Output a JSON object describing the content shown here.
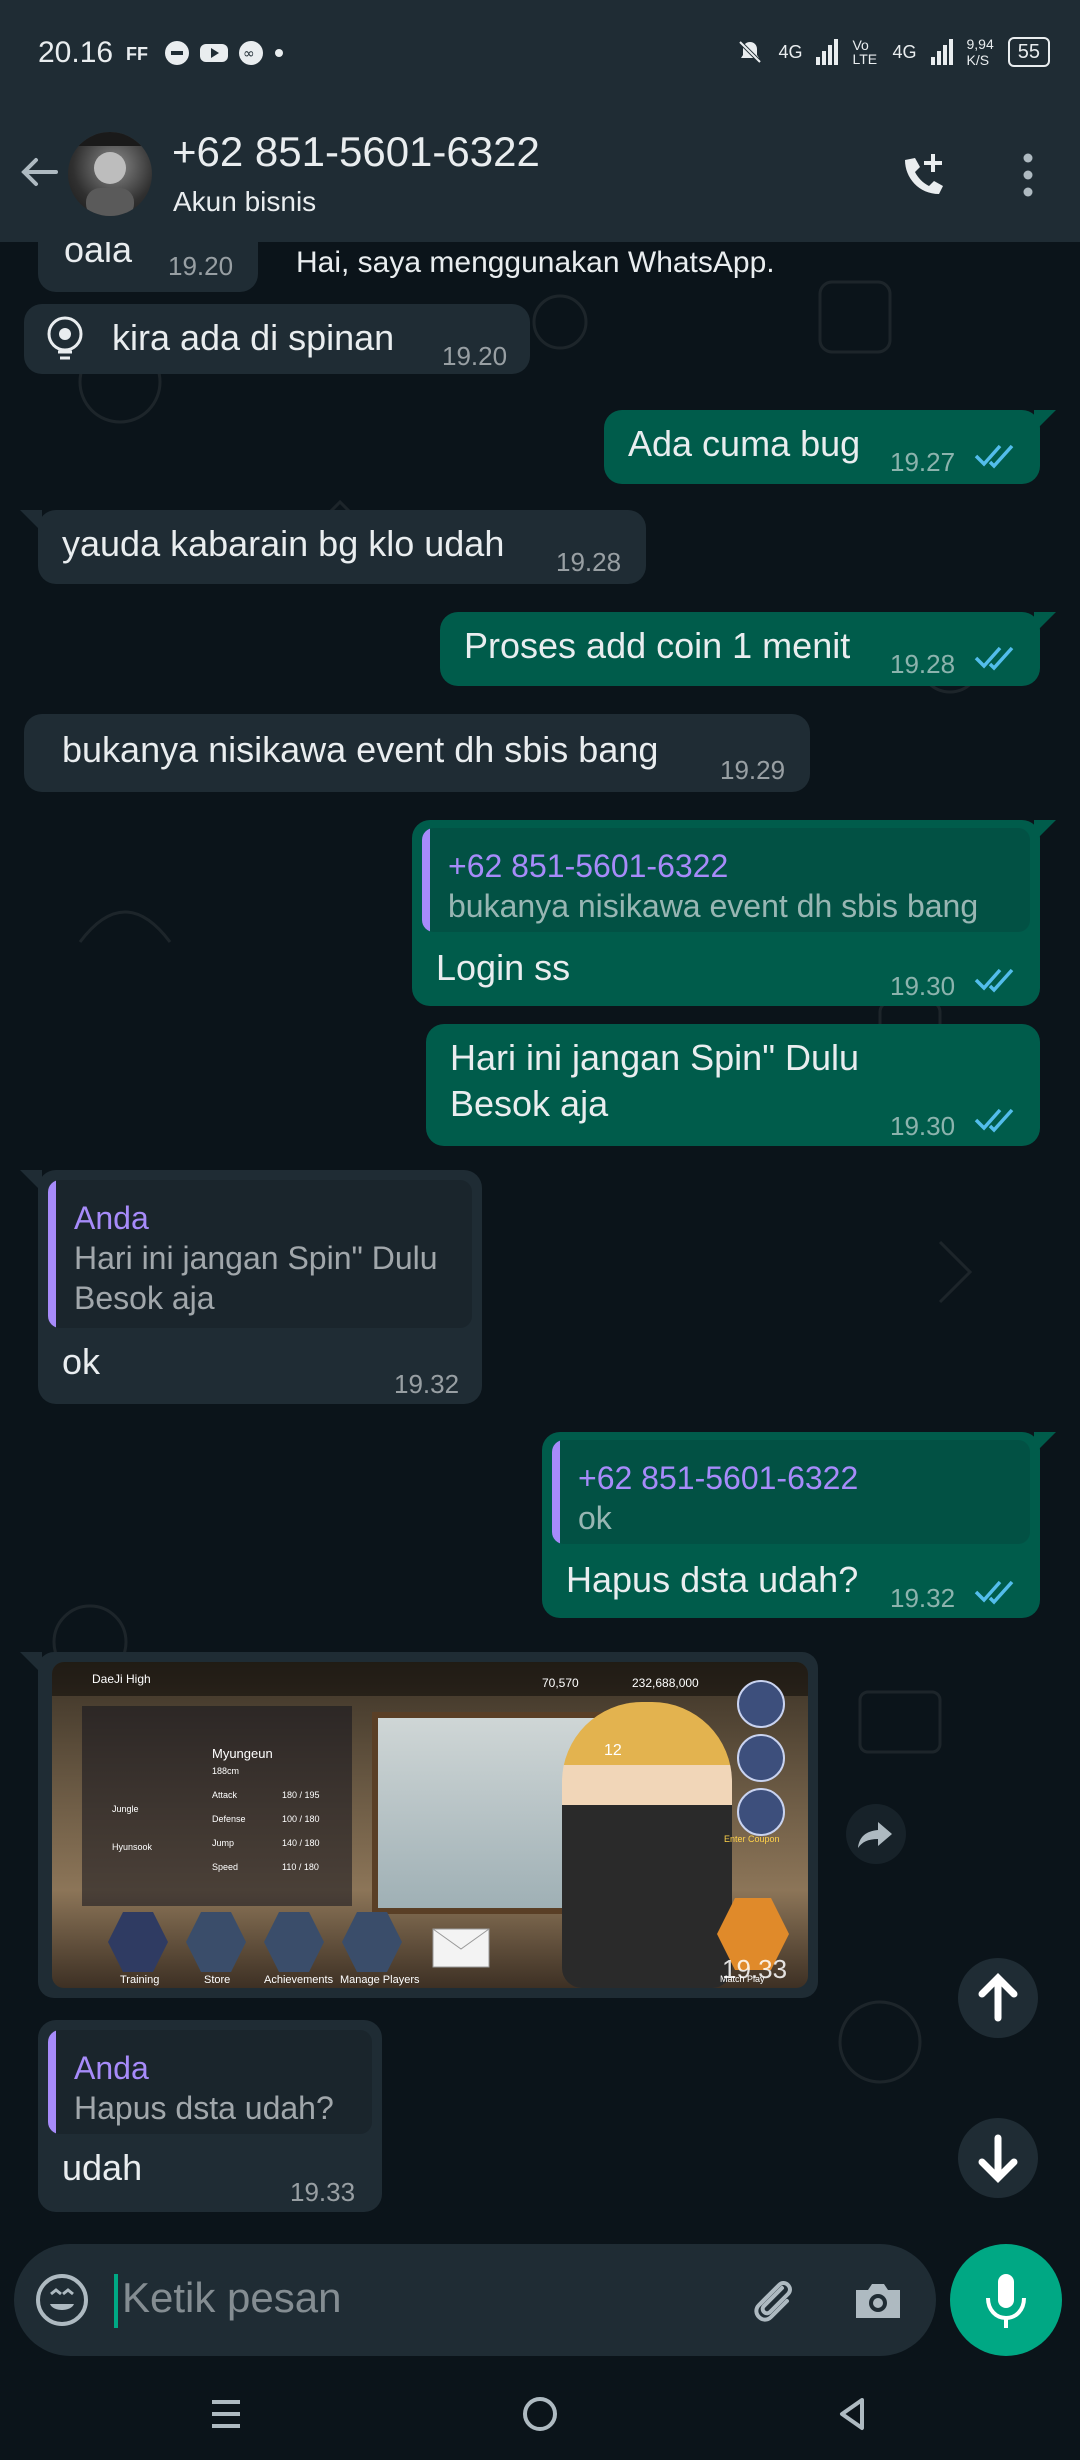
{
  "status_bar": {
    "time": "20.16",
    "net1": "4G",
    "volte": "Vo LTE",
    "net2": "4G",
    "speed": "9,94",
    "speed_unit": "K/S",
    "battery": "55"
  },
  "header": {
    "contact_name": "+62 851-5601-6322",
    "subtitle": "Akun bisnis"
  },
  "messages": [
    {
      "text": "oala",
      "time": "19.20"
    },
    {
      "text": "Hai, saya menggunakan WhatsApp."
    },
    {
      "text": "kira ada di spinan",
      "time": "19.20"
    },
    {
      "text": "Ada cuma bug",
      "time": "19.27"
    },
    {
      "text": "yauda kabarain bg klo udah",
      "time": "19.28"
    },
    {
      "text": "Proses add coin 1 menit",
      "time": "19.28"
    },
    {
      "text": "bukanya nisikawa event dh sbis bang",
      "time": "19.29"
    },
    {
      "quote_name": "+62 851-5601-6322",
      "quote_text": "bukanya nisikawa event dh sbis bang",
      "text": "Login ss",
      "time": "19.30"
    },
    {
      "text_line1": "Hari ini jangan Spin\" Dulu",
      "text_line2": "Besok aja",
      "time": "19.30"
    },
    {
      "quote_name": "Anda",
      "quote_line1": "Hari ini jangan Spin\" Dulu",
      "quote_line2": "Besok aja",
      "text": "ok",
      "time": "19.32"
    },
    {
      "quote_name": "+62 851-5601-6322",
      "quote_text": "ok",
      "text": "Hapus dsta udah?",
      "time": "19.32"
    },
    {
      "image_caption": "game screenshot",
      "time": "19.33",
      "image_text": {
        "school": "DaeJi High",
        "coins": "70,570",
        "gold": "232,688,000",
        "player": "Myungeun",
        "height": "188cm",
        "attack": "Attack",
        "defense": "Defense",
        "jump": "Jump",
        "speed": "Speed",
        "stat1": "180 / 195",
        "stat2": "100 / 180",
        "stat3": "140 / 180",
        "stat4": "110 / 180",
        "jungle": "Jungle",
        "hyunsook": "Hyunsook",
        "training": "Training",
        "store": "Store",
        "achievements": "Achievements",
        "manage": "Manage Players",
        "coupon": "Enter Coupon",
        "match": "Match Play",
        "jersey": "12"
      }
    },
    {
      "quote_name": "Anda",
      "quote_text": "Hapus dsta udah?",
      "text": "udah",
      "time": "19.33"
    }
  ],
  "input": {
    "placeholder": "Ketik pesan"
  },
  "colors": {
    "incoming": "#1f2c34",
    "outgoing": "#005c4b",
    "accent": "#00a884",
    "read_tick": "#53bdeb",
    "quote_name": "#a78bfa"
  }
}
